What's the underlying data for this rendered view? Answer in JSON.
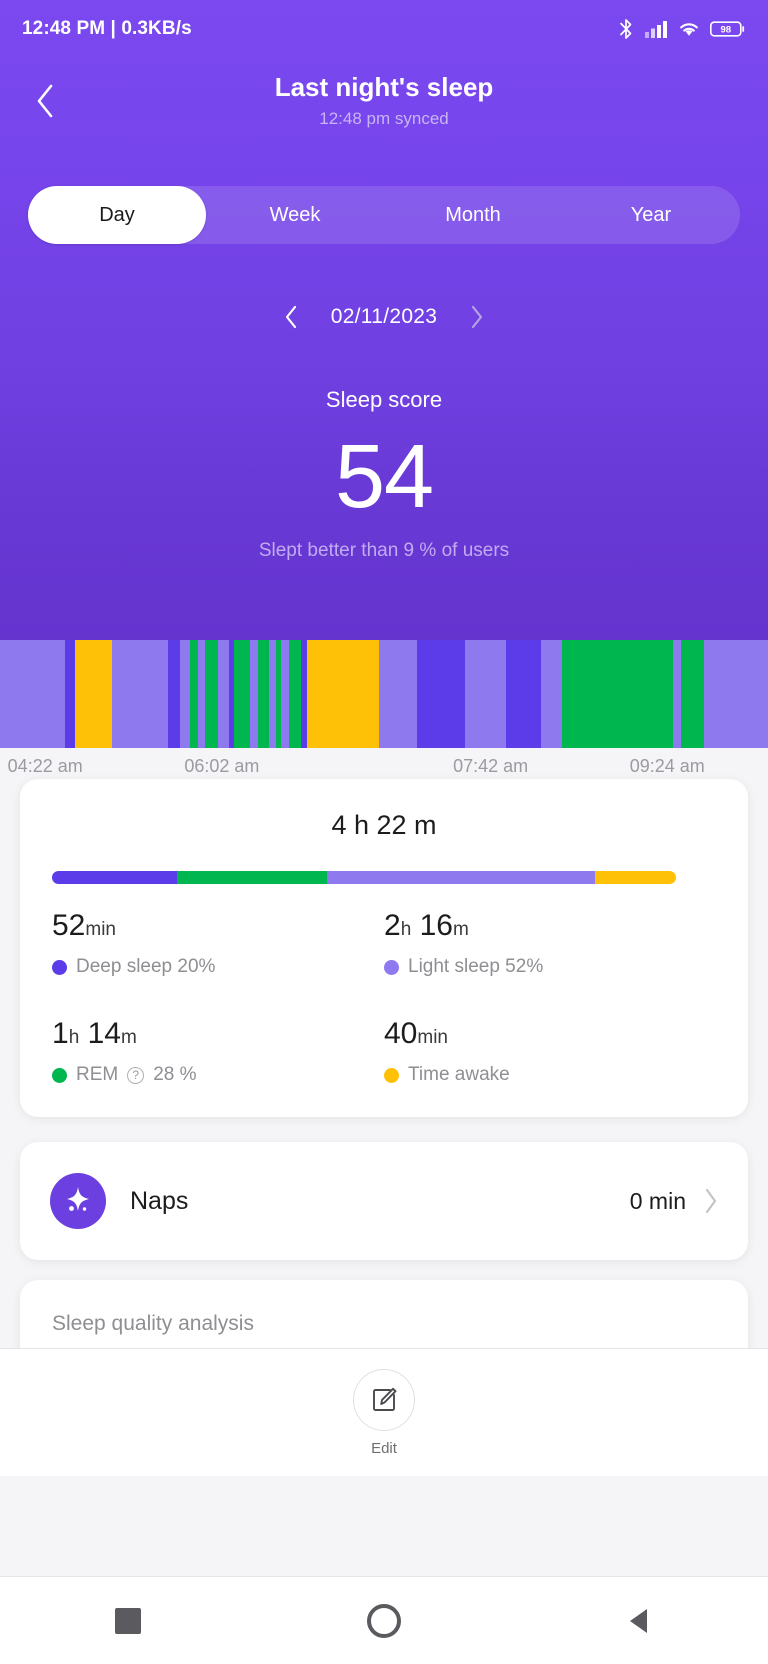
{
  "status_bar": {
    "time_and_speed": "12:48 PM | 0.3KB/s",
    "icons": [
      "bluetooth-icon",
      "cellular-signal-icon",
      "wifi-icon",
      "battery-icon"
    ],
    "battery_level": "98"
  },
  "header": {
    "back_icon": "chevron-left-icon",
    "title": "Last night's sleep",
    "subtitle": "12:48 pm synced"
  },
  "tabs": {
    "items": [
      {
        "label": "Day",
        "active": true
      },
      {
        "label": "Week",
        "active": false
      },
      {
        "label": "Month",
        "active": false
      },
      {
        "label": "Year",
        "active": false
      }
    ]
  },
  "date_nav": {
    "prev_icon": "chevron-left-icon",
    "date": "02/11/2023",
    "next_icon": "chevron-right-icon"
  },
  "score": {
    "label": "Sleep score",
    "value": "54",
    "note": "Slept better than 9 % of users"
  },
  "colors": {
    "hero_purple": "#7745ec",
    "deep_sleep": "#5b3ce8",
    "light_sleep": "#8e79ef",
    "rem": "#00b74f",
    "awake": "#ffc107",
    "card_white": "#ffffff",
    "page_bg": "#f5f5f7"
  },
  "chart_data": {
    "type": "bar",
    "title": "Sleep stage hypnogram",
    "xlabel": "",
    "ylabel": "",
    "grid": false,
    "legend_position": "below-card",
    "x_tick_labels": [
      "04:22 am",
      "06:02 am",
      "07:42 am",
      "09:24 am"
    ],
    "x_tick_positions_pct": [
      1,
      24,
      59,
      82
    ],
    "stage_colors": {
      "deep": "#5b3ce8",
      "light": "#8e79ef",
      "rem": "#00b74f",
      "awake": "#ffc107"
    },
    "segments": [
      {
        "stage": "light",
        "width_pct": 8.5
      },
      {
        "stage": "deep",
        "width_pct": 1.3
      },
      {
        "stage": "awake",
        "width_pct": 4.8
      },
      {
        "stage": "light",
        "width_pct": 7.3
      },
      {
        "stage": "deep",
        "width_pct": 1.6
      },
      {
        "stage": "light",
        "width_pct": 1.2
      },
      {
        "stage": "rem",
        "width_pct": 1.1
      },
      {
        "stage": "light",
        "width_pct": 0.9
      },
      {
        "stage": "rem",
        "width_pct": 1.7
      },
      {
        "stage": "light",
        "width_pct": 1.4
      },
      {
        "stage": "deep",
        "width_pct": 0.7
      },
      {
        "stage": "rem",
        "width_pct": 2.1
      },
      {
        "stage": "light",
        "width_pct": 1.0
      },
      {
        "stage": "rem",
        "width_pct": 1.5
      },
      {
        "stage": "light",
        "width_pct": 0.8
      },
      {
        "stage": "rem",
        "width_pct": 0.7
      },
      {
        "stage": "light",
        "width_pct": 1.0
      },
      {
        "stage": "rem",
        "width_pct": 1.6
      },
      {
        "stage": "deep",
        "width_pct": 0.8
      },
      {
        "stage": "awake",
        "width_pct": 9.3
      },
      {
        "stage": "light",
        "width_pct": 5.0
      },
      {
        "stage": "deep",
        "width_pct": 6.2
      },
      {
        "stage": "light",
        "width_pct": 5.4
      },
      {
        "stage": "deep",
        "width_pct": 4.6
      },
      {
        "stage": "light",
        "width_pct": 2.7
      },
      {
        "stage": "rem",
        "width_pct": 14.5
      },
      {
        "stage": "light",
        "width_pct": 1.0
      },
      {
        "stage": "rem",
        "width_pct": 3.0
      },
      {
        "stage": "light",
        "width_pct": 8.3
      }
    ]
  },
  "summary": {
    "total_duration": "4 h 22 m",
    "stack_bar": [
      {
        "stage": "deep",
        "pct": 20
      },
      {
        "stage": "rem",
        "pct": 24
      },
      {
        "stage": "light",
        "pct": 43
      },
      {
        "stage": "awake",
        "pct": 13
      }
    ],
    "stats": [
      {
        "value_num": "52",
        "value_unit": "min",
        "dot_color": "#5b3ce8",
        "label": "Deep sleep 20%",
        "has_help_icon": false
      },
      {
        "value_num": "2",
        "value_unit": "h",
        "value_num2": "16",
        "value_unit2": "m",
        "dot_color": "#8e79ef",
        "label": "Light sleep 52%",
        "has_help_icon": false
      },
      {
        "value_num": "1",
        "value_unit": "h",
        "value_num2": "14",
        "value_unit2": "m",
        "dot_color": "#00b74f",
        "label_pre": "REM",
        "label": "28 %",
        "has_help_icon": true
      },
      {
        "value_num": "40",
        "value_unit": "min",
        "dot_color": "#ffc107",
        "label": "Time awake",
        "has_help_icon": false
      }
    ]
  },
  "naps": {
    "icon": "sparkle-icon",
    "label": "Naps",
    "value": "0 min",
    "chevron_icon": "chevron-right-icon"
  },
  "quality": {
    "title": "Sleep quality analysis"
  },
  "edit_bar": {
    "icon": "edit-pencil-icon",
    "label": "Edit"
  },
  "navbar": {
    "recents_icon": "square-icon",
    "home_icon": "circle-icon",
    "back_icon": "triangle-back-icon"
  }
}
